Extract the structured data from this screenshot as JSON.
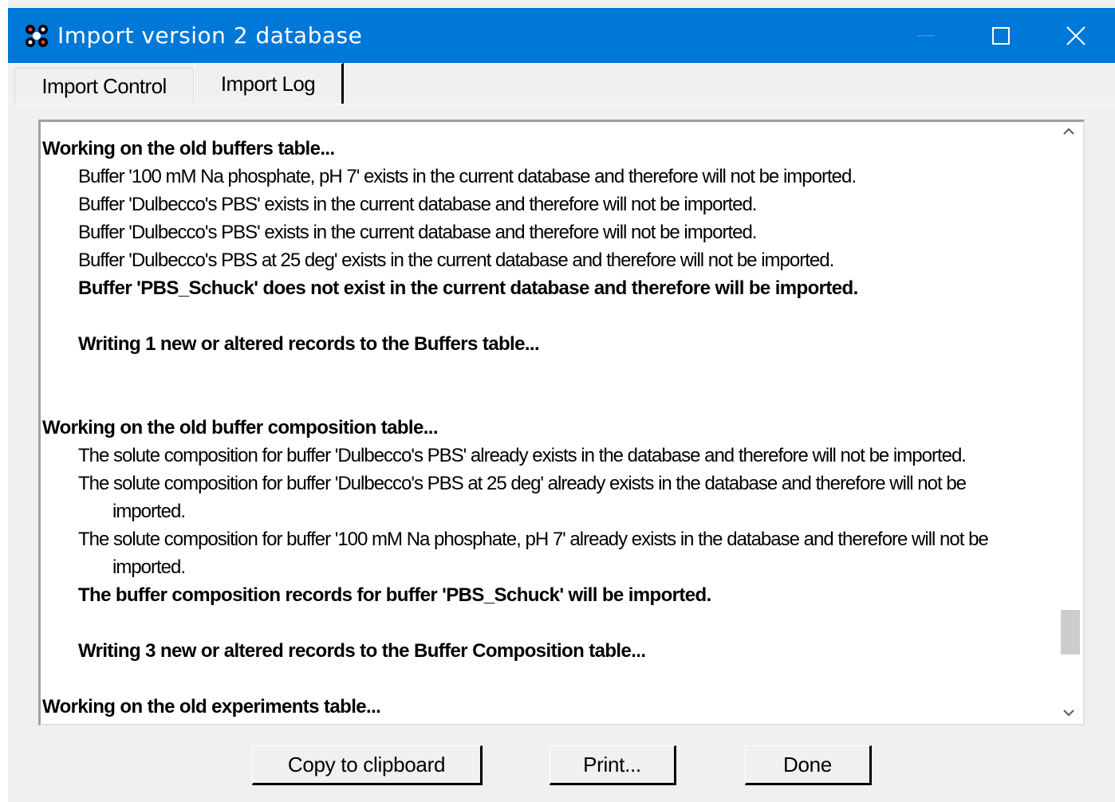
{
  "window": {
    "title": "Import version 2 database",
    "app_icon": "database-app-icon",
    "controls": [
      "minimize-icon",
      "maximize-icon",
      "close-icon"
    ]
  },
  "tabs": [
    {
      "label": "Import Control",
      "active": false
    },
    {
      "label": "Import Log",
      "active": true
    }
  ],
  "log": {
    "lines": [
      "Working on the old buffers table...",
      "Buffer '100 mM Na phosphate, pH 7' exists in the current database and therefore will not be imported.",
      "Buffer 'Dulbecco's PBS' exists in the current database and therefore will not be imported.",
      "Buffer 'Dulbecco's PBS' exists in the current database and therefore will not be imported.",
      "Buffer 'Dulbecco's PBS at 25 deg' exists in the current database and therefore will not be imported.",
      "Buffer 'PBS_Schuck' does not exist in the current database and therefore will be imported.",
      "",
      "Writing 1 new or altered records to the Buffers table...",
      "",
      "",
      "Working on the old buffer composition table...",
      "The solute composition for buffer 'Dulbecco's PBS' already exists in the database and therefore will not be imported.",
      "The solute composition for buffer 'Dulbecco's PBS at 25 deg' already exists in the database and therefore will not be",
      "imported.",
      "The solute composition for buffer '100 mM Na phosphate, pH 7' already exists in the database and therefore will not be",
      "imported.",
      "The buffer composition records for buffer 'PBS_Schuck' will be imported.",
      "",
      "Writing 3 new or altered records to the Buffer Composition table...",
      "",
      "Working on the old experiments table..."
    ]
  },
  "buttons": {
    "copy": "Copy to clipboard",
    "print": "Print...",
    "done": "Done"
  },
  "scrollbar": {
    "position_fraction": 0.86
  }
}
